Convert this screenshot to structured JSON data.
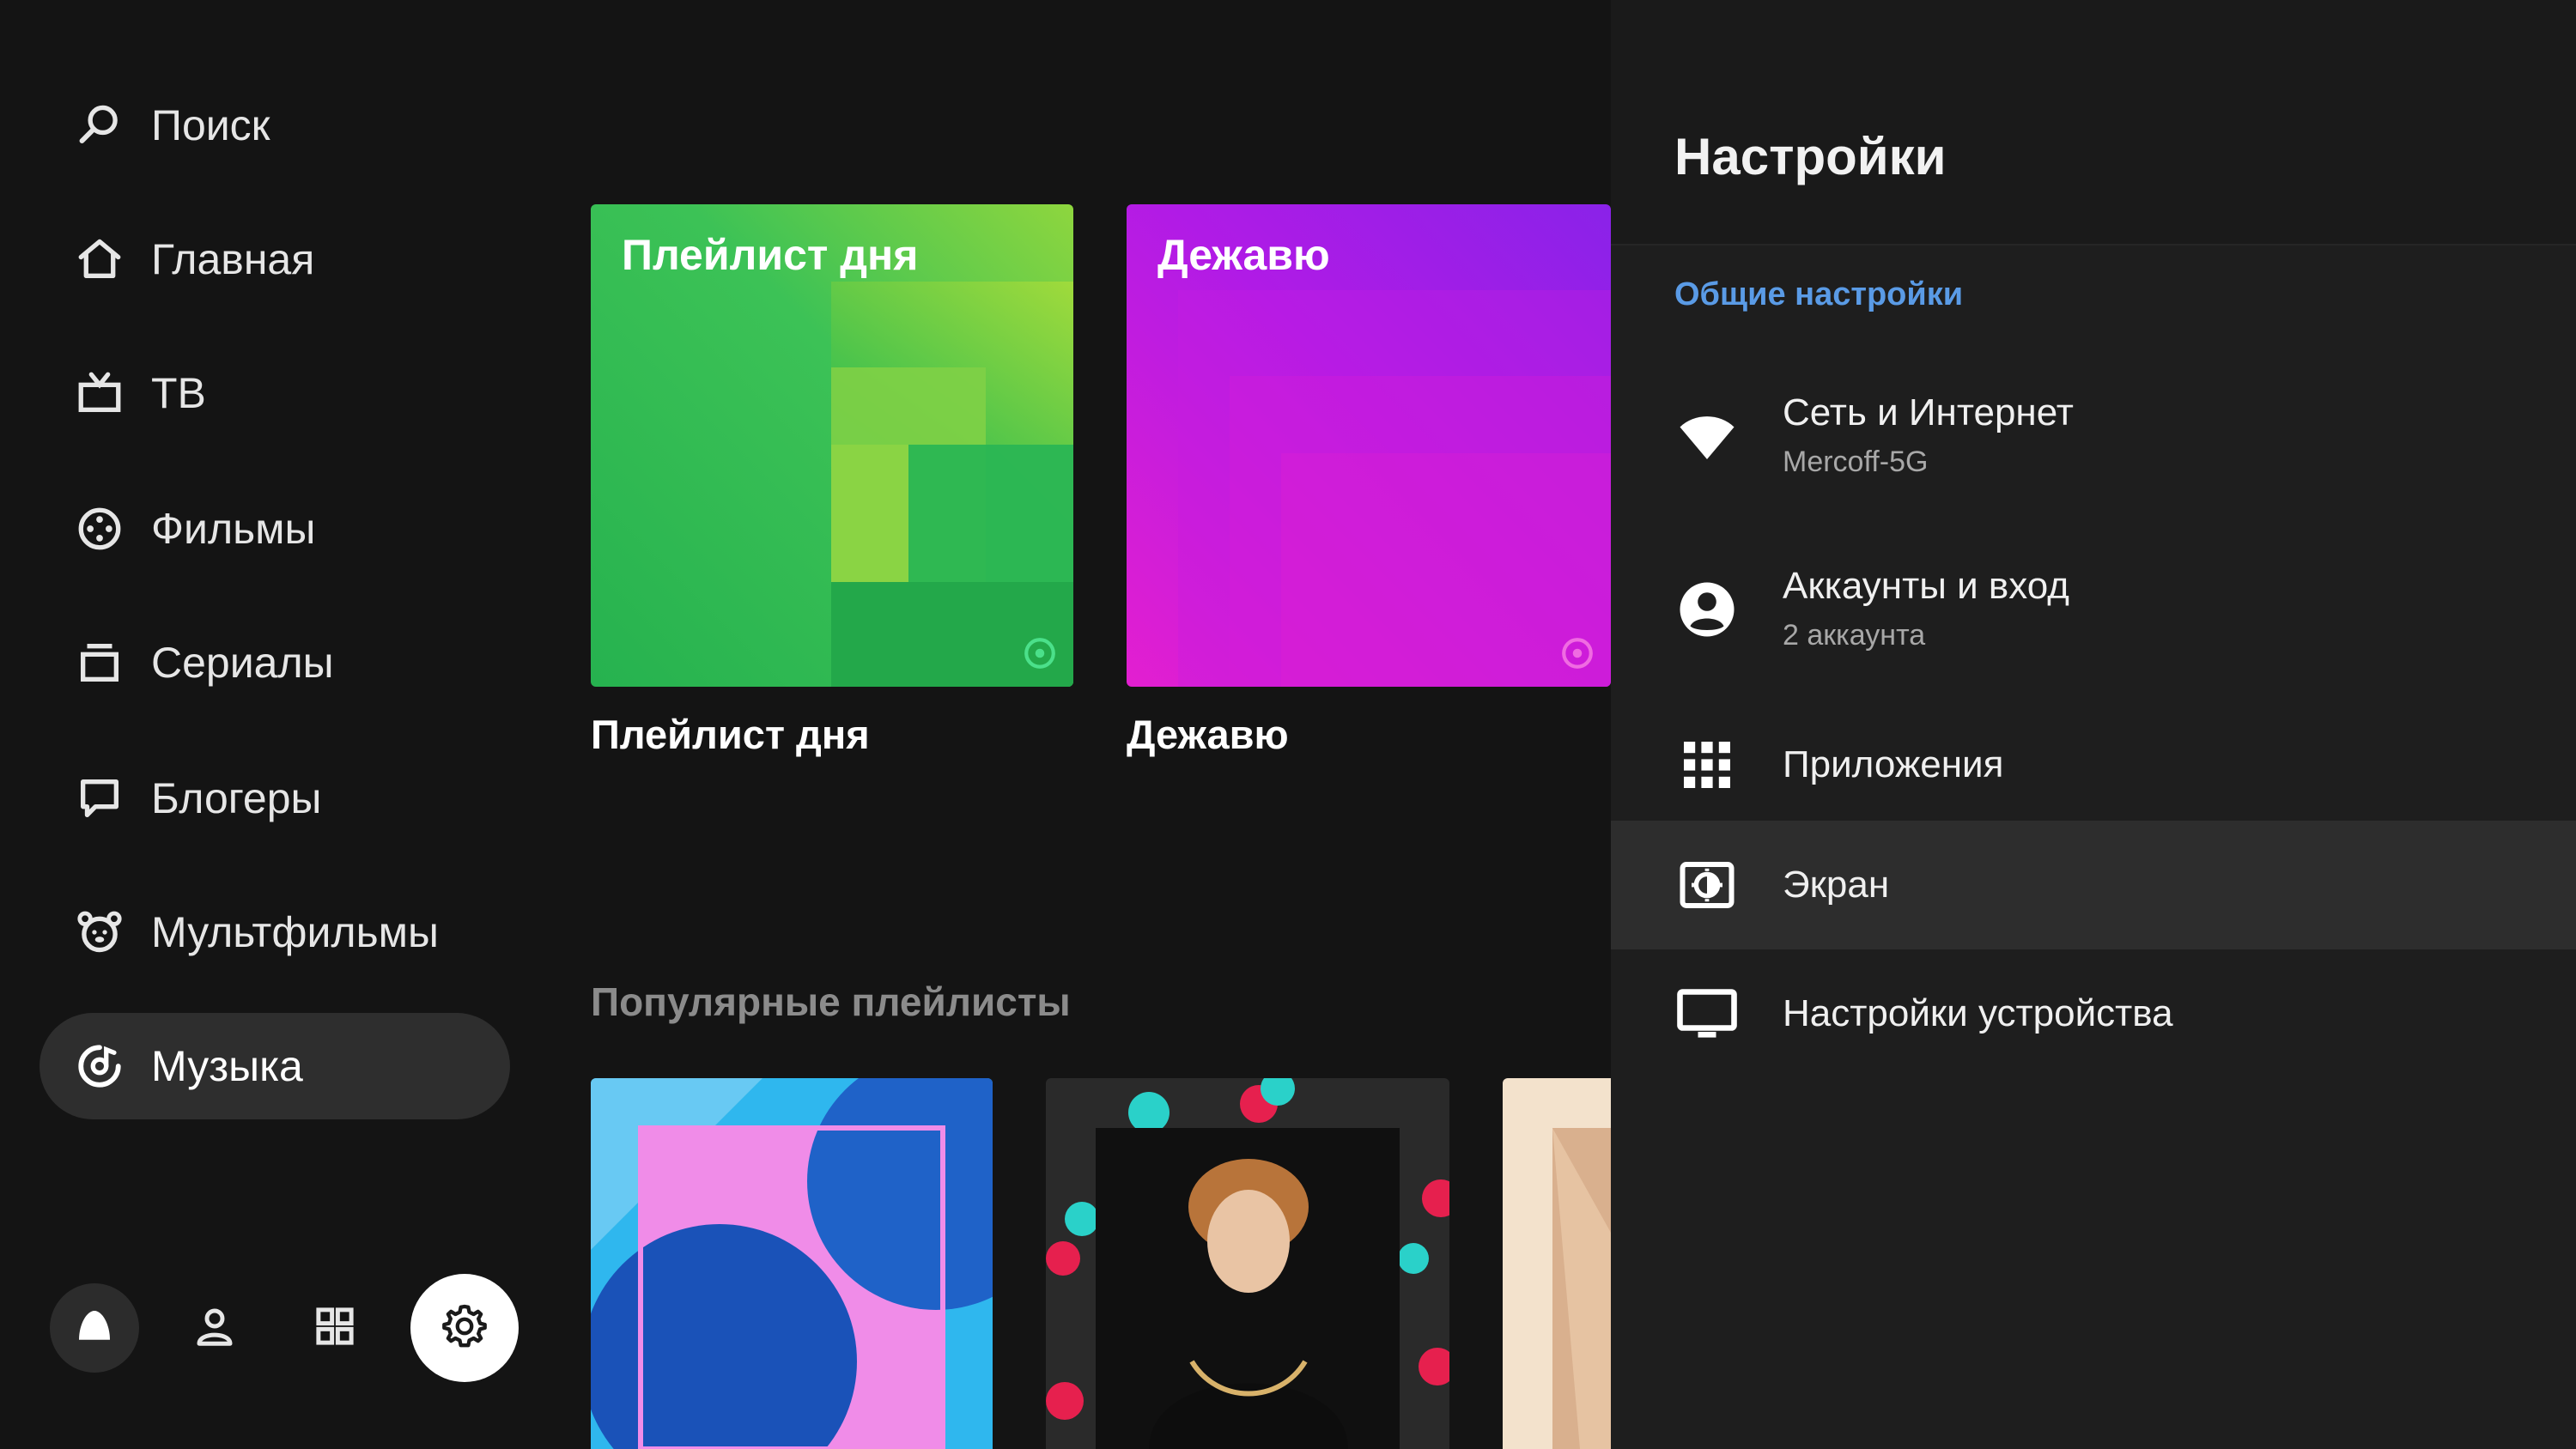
{
  "nav": {
    "items": [
      {
        "label": "Поиск",
        "icon": "search-icon"
      },
      {
        "label": "Главная",
        "icon": "home-icon"
      },
      {
        "label": "ТВ",
        "icon": "tv-icon"
      },
      {
        "label": "Фильмы",
        "icon": "film-reel-icon"
      },
      {
        "label": "Сериалы",
        "icon": "series-icon"
      },
      {
        "label": "Блогеры",
        "icon": "chat-bubble-icon"
      },
      {
        "label": "Мультфильмы",
        "icon": "bear-face-icon"
      },
      {
        "label": "Музыка",
        "icon": "music-disc-icon",
        "active": true
      }
    ]
  },
  "bottom_bar": {
    "buttons": [
      {
        "icon": "alice-icon"
      },
      {
        "icon": "profile-icon"
      },
      {
        "icon": "apps-grid-icon"
      },
      {
        "icon": "gear-icon",
        "selected": true
      }
    ]
  },
  "content": {
    "featured": [
      {
        "title": "Плейлист дня",
        "caption": "Плейлист дня",
        "color": "#2fbf5b"
      },
      {
        "title": "Дежавю",
        "caption": "Дежавю",
        "color": "#b21fe8"
      }
    ],
    "section_title": "Популярные плейлисты"
  },
  "settings": {
    "title": "Настройки",
    "section": "Общие настройки",
    "items": [
      {
        "label": "Сеть и Интернет",
        "sub": "Mercoff-5G",
        "icon": "wifi-icon"
      },
      {
        "label": "Аккаунты и вход",
        "sub": "2 аккаунта",
        "icon": "account-circle-icon"
      },
      {
        "label": "Приложения",
        "sub": "",
        "icon": "apps-icon"
      },
      {
        "label": "Экран",
        "sub": "",
        "icon": "brightness-icon",
        "focused": true
      },
      {
        "label": "Настройки устройства",
        "sub": "",
        "icon": "monitor-icon"
      }
    ]
  },
  "colors": {
    "background": "#141414",
    "panel": "#1e1e1e",
    "accent": "#5a9be6",
    "nav_active": "#2e2e2e"
  }
}
